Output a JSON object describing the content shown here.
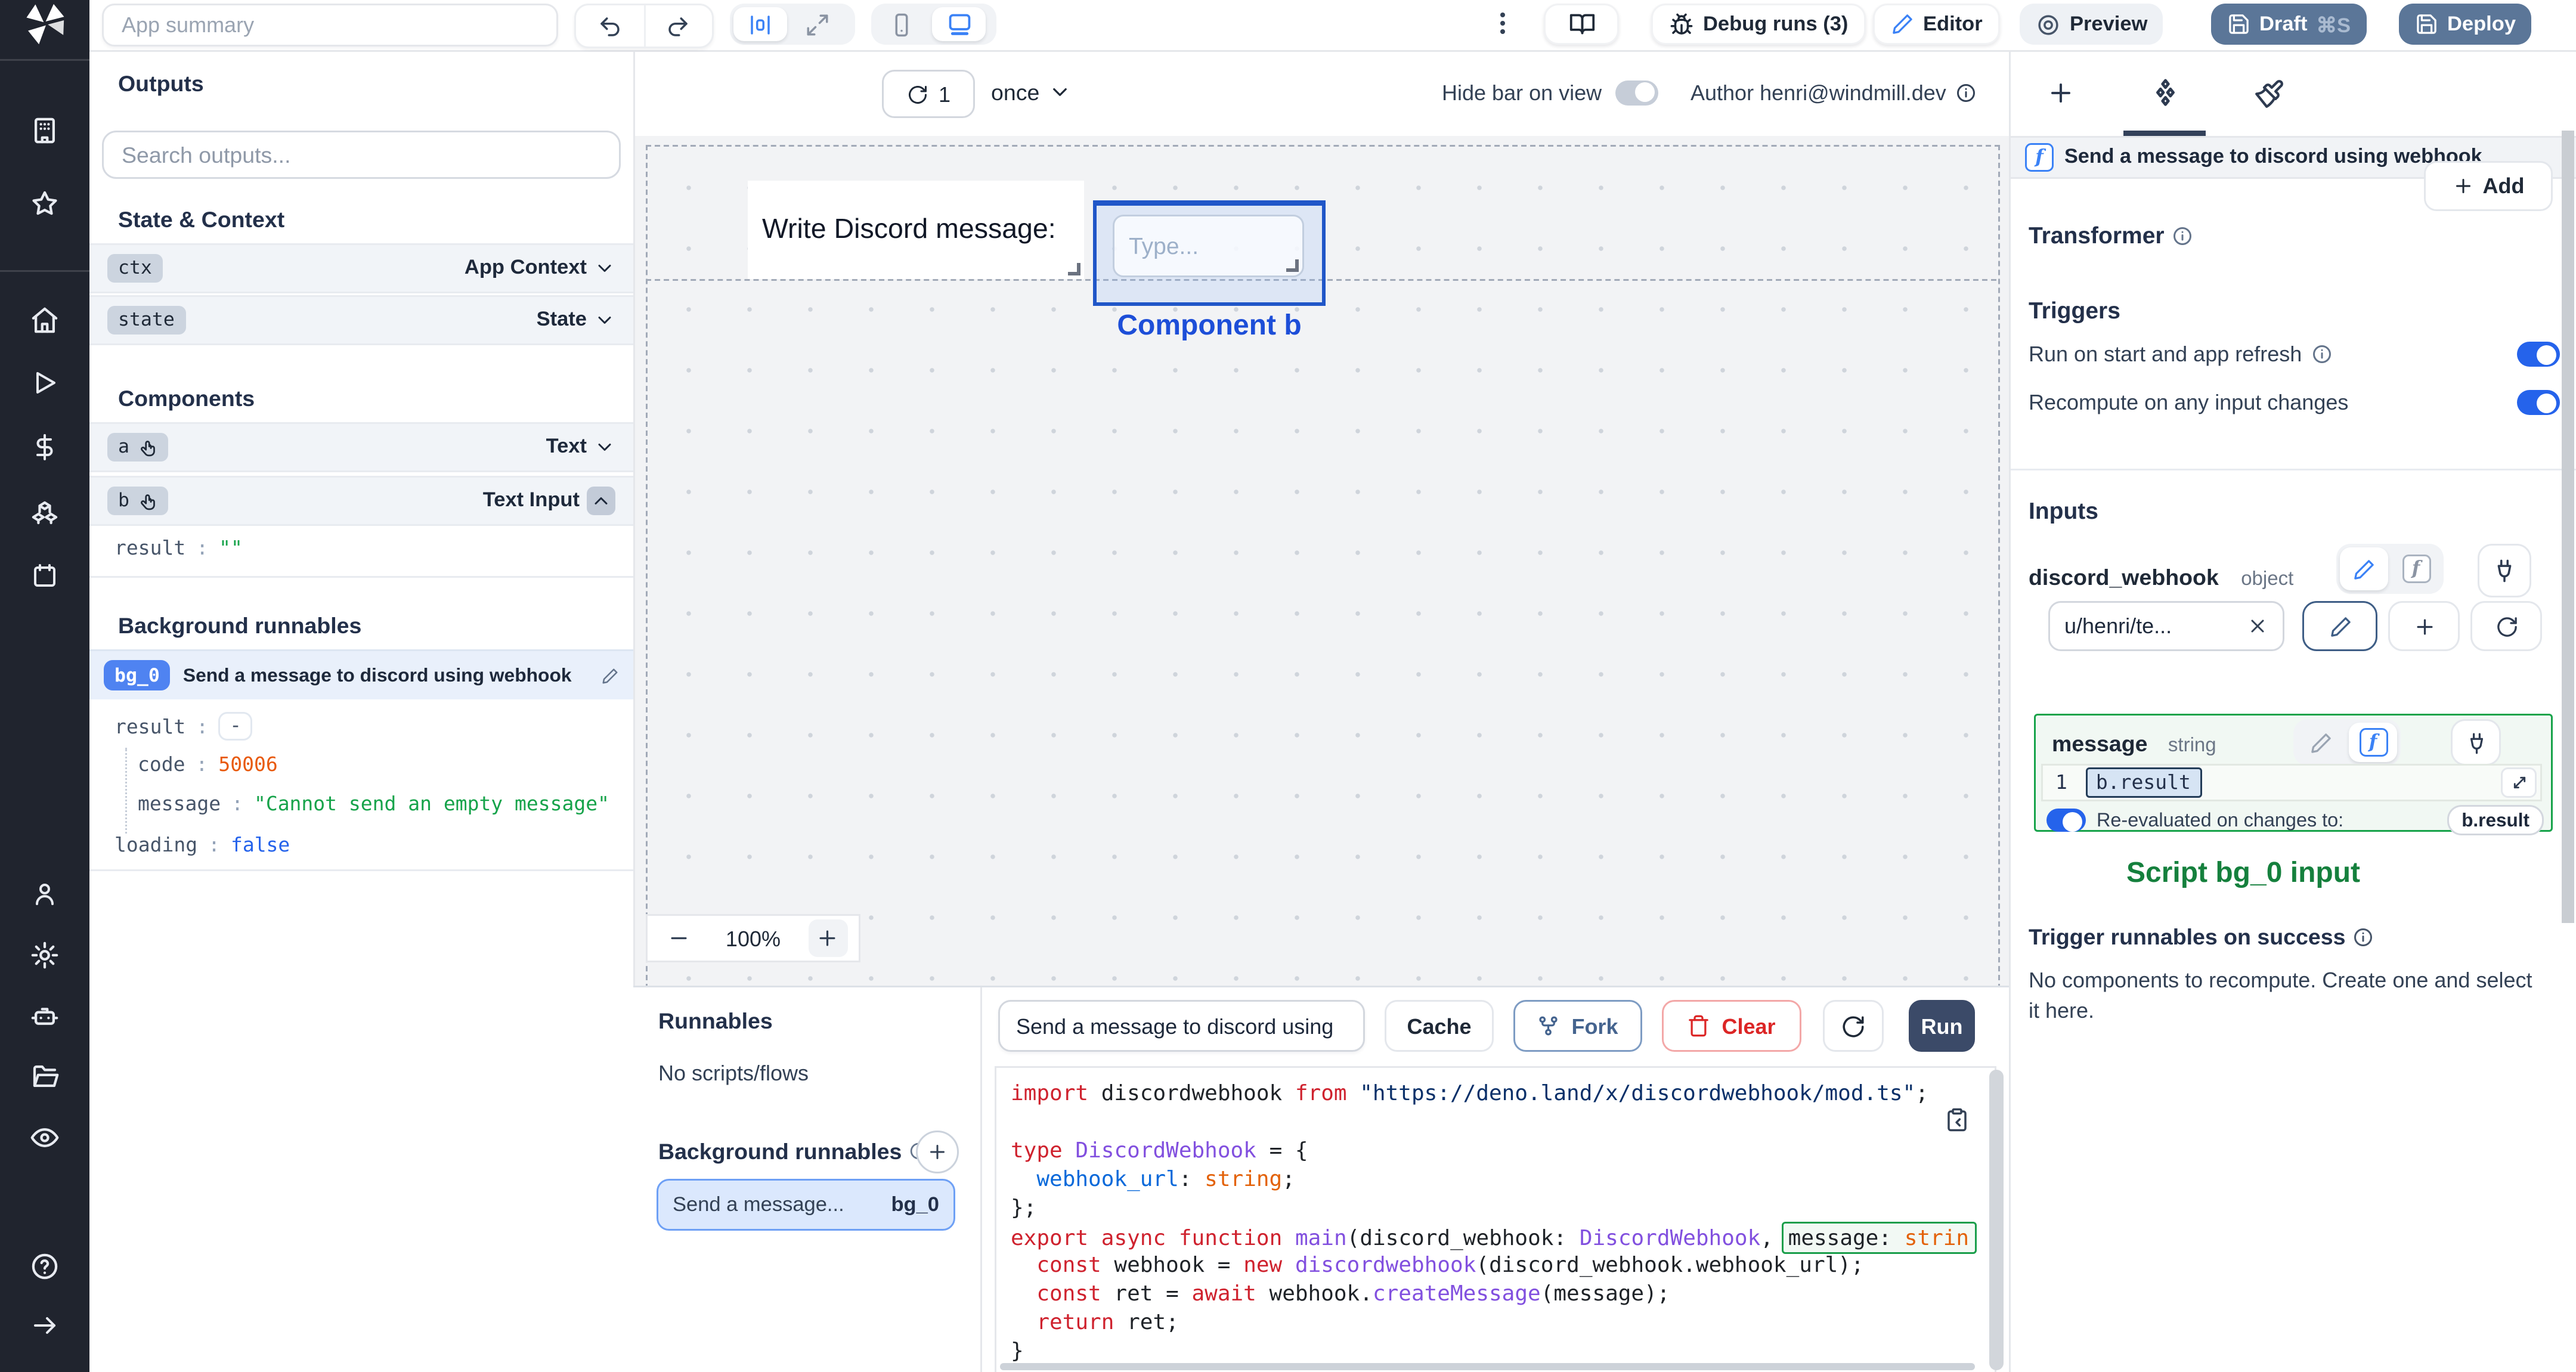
{
  "topbar": {
    "app_summary_placeholder": "App summary",
    "debug_runs_label": "Debug runs (3)",
    "editor_label": "Editor",
    "preview_label": "Preview",
    "draft_label": "Draft",
    "draft_shortcut": "⌘S",
    "deploy_label": "Deploy"
  },
  "canvas": {
    "header": {
      "refresh_count": "1",
      "frequency": "once",
      "hide_bar_label": "Hide bar on view",
      "author_label": "Author henri@windmill.dev"
    },
    "artboard": {
      "text_component": "Write Discord message:",
      "input_placeholder": "Type...",
      "selection_label": "Component b"
    },
    "zoom_level": "100%"
  },
  "outputs": {
    "title": "Outputs",
    "search_placeholder": "Search outputs...",
    "state_section": "State & Context",
    "ctx_key": "ctx",
    "ctx_type": "App Context",
    "state_key": "state",
    "state_type": "State",
    "components_section": "Components",
    "a_key": "a",
    "a_type": "Text",
    "b_key": "b",
    "b_type": "Text Input",
    "b_result_key": "result",
    "b_result_value": "\"\"",
    "background_section": "Background runnables",
    "bg0": {
      "badge": "bg_0",
      "title": "Send a message to discord using webhook",
      "result_key": "result",
      "result_value": "-",
      "code_key": "code",
      "code_value": "50006",
      "message_key": "message",
      "message_value": "\"Cannot send an empty message\"",
      "loading_key": "loading",
      "loading_value": "false"
    }
  },
  "runnables": {
    "title": "Runnables",
    "empty_label": "No scripts/flows",
    "background_title": "Background runnables",
    "item_title": "Send a message...",
    "item_badge": "bg_0"
  },
  "editor": {
    "script_name": "Send a message to discord using",
    "cache_label": "Cache",
    "fork_label": "Fork",
    "clear_label": "Clear",
    "run_label": "Run",
    "code": [
      {
        "t": [
          [
            "k",
            "import"
          ],
          [
            "d",
            " discordwebhook "
          ],
          [
            "k",
            "from"
          ],
          [
            "s",
            " \"https://deno.land/x/discordwebhook/mod.ts\""
          ],
          [
            "d",
            ";"
          ]
        ]
      },
      {
        "t": []
      },
      {
        "t": [
          [
            "k",
            "type"
          ],
          [
            "d",
            " "
          ],
          [
            "t",
            "DiscordWebhook"
          ],
          [
            "d",
            " = {"
          ]
        ]
      },
      {
        "t": [
          [
            "d",
            "  "
          ],
          [
            "p",
            "webhook_url"
          ],
          [
            "d",
            ": "
          ],
          [
            "b",
            "string"
          ],
          [
            "d",
            ";"
          ]
        ]
      },
      {
        "t": [
          [
            "d",
            "};"
          ]
        ]
      },
      {
        "t": [
          [
            "k",
            "export"
          ],
          [
            "d",
            " "
          ],
          [
            "k",
            "async"
          ],
          [
            "d",
            " "
          ],
          [
            "k",
            "function"
          ],
          [
            "d",
            " "
          ],
          [
            "t",
            "main"
          ],
          [
            "d",
            "(discord_webhook: "
          ],
          [
            "t",
            "DiscordWebhook"
          ],
          [
            "d",
            ", "
          ]
        ],
        "box": [
          [
            "d",
            "message: "
          ],
          [
            "b",
            "strin"
          ]
        ]
      },
      {
        "t": [
          [
            "d",
            "  "
          ],
          [
            "k",
            "const"
          ],
          [
            "d",
            " webhook = "
          ],
          [
            "k",
            "new"
          ],
          [
            "d",
            " "
          ],
          [
            "t",
            "discordwebhook"
          ],
          [
            "d",
            "(discord_webhook.webhook_url);"
          ]
        ]
      },
      {
        "t": [
          [
            "d",
            "  "
          ],
          [
            "k",
            "const"
          ],
          [
            "d",
            " ret = "
          ],
          [
            "k",
            "await"
          ],
          [
            "d",
            " webhook."
          ],
          [
            "t",
            "createMessage"
          ],
          [
            "d",
            "(message);"
          ]
        ]
      },
      {
        "t": [
          [
            "d",
            "  "
          ],
          [
            "k",
            "return"
          ],
          [
            "d",
            " ret;"
          ]
        ]
      },
      {
        "t": [
          [
            "d",
            "}"
          ]
        ]
      }
    ]
  },
  "inspector": {
    "header_title": "Send a message to discord using webhook",
    "transformer_label": "Transformer",
    "add_label": "Add",
    "triggers_title": "Triggers",
    "trigger_row1": "Run on start and app refresh",
    "trigger_row2": "Recompute on any input changes",
    "inputs_title": "Inputs",
    "discord_webhook": {
      "name": "discord_webhook",
      "type": "object",
      "value": "u/henri/te..."
    },
    "message": {
      "name": "message",
      "type": "string",
      "line_number": "1",
      "expression": "b.result",
      "reeval_label": "Re-evaluated on changes to:",
      "reeval_target": "b.result"
    },
    "annotation": "Script bg_0 input",
    "on_success_title": "Trigger runnables on success",
    "on_success_empty": "No components to recompute. Create one and select it here."
  },
  "colors": {
    "accent_blue": "#2563eb",
    "selection_blue": "#1d4ed8",
    "badge_blue": "#4f83f1",
    "success_green": "#16a34a",
    "slate_button": "#5b7698",
    "run_button": "#3b4a68"
  }
}
